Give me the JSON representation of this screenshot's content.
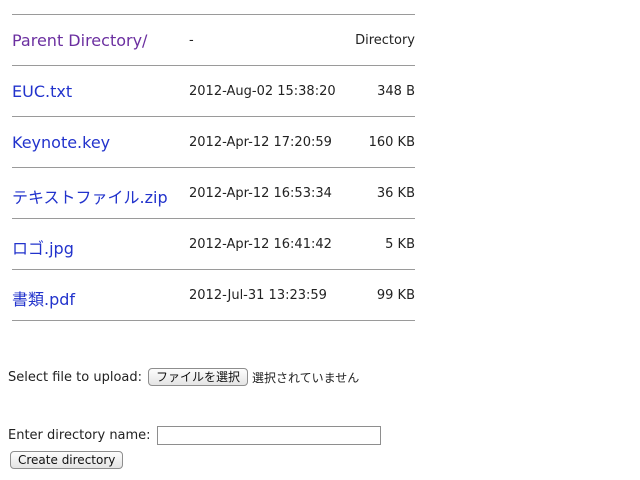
{
  "files": [
    {
      "name": "Parent Directory/",
      "date": "-",
      "size": "Directory",
      "visited": true
    },
    {
      "name": "EUC.txt",
      "date": "2012-Aug-02 15:38:20",
      "size": "348 B",
      "visited": false
    },
    {
      "name": "Keynote.key",
      "date": "2012-Apr-12 17:20:59",
      "size": "160 KB",
      "visited": false
    },
    {
      "name": "テキストファイル.zip",
      "date": "2012-Apr-12 16:53:34",
      "size": "36 KB",
      "visited": false
    },
    {
      "name": "ロゴ.jpg",
      "date": "2012-Apr-12 16:41:42",
      "size": "5 KB",
      "visited": false
    },
    {
      "name": "書類.pdf",
      "date": "2012-Jul-31 13:23:59",
      "size": "99 KB",
      "visited": false
    }
  ],
  "upload": {
    "label": "Select file to upload:",
    "button": "ファイルを選択",
    "status": "選択されていません"
  },
  "directory": {
    "label": "Enter directory name:",
    "value": "",
    "button": "Create directory"
  },
  "colors": {
    "link": "#2233cc",
    "visited_link": "#6b2fa0",
    "rule": "#9a9a9a"
  }
}
